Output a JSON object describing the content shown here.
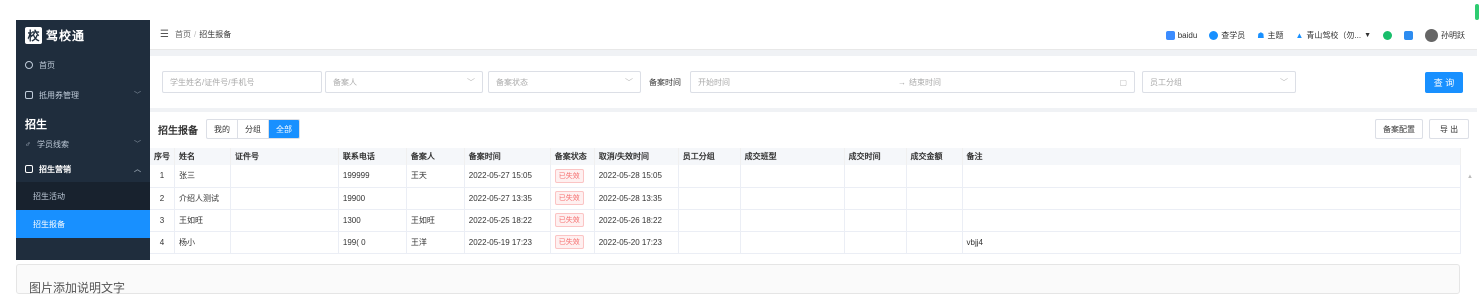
{
  "app": {
    "logo_char": "校",
    "name": "驾校通"
  },
  "sidebar": {
    "items": [
      {
        "label": "首页"
      },
      {
        "label": "抵用券管理"
      }
    ],
    "group": "招生",
    "lead_item": "学员线索",
    "marketing_item": "招生营销",
    "sub_items": [
      {
        "label": "招生活动"
      },
      {
        "label": "招生报备"
      }
    ]
  },
  "breadcrumb": {
    "home": "首页",
    "sep": "/",
    "current": "招生报备"
  },
  "topbar": {
    "baidu": "baidu",
    "students": "查学员",
    "theme": "主题",
    "school": "青山驾校（勿...",
    "user": "孙明跃"
  },
  "filter": {
    "student_placeholder": "学生姓名/证件号/手机号",
    "reporter_placeholder": "备案人",
    "status_placeholder": "备案状态",
    "time_label": "备案时间",
    "start_placeholder": "开始时间",
    "range_arrow": "→",
    "end_placeholder": "结束时间",
    "group_placeholder": "员工分组",
    "query_label": "查 询"
  },
  "panel": {
    "title": "招生报备",
    "tabs": [
      "我的",
      "分组",
      "全部"
    ],
    "active_tab": "全部",
    "config_label": "备案配置",
    "export_label": "导 出"
  },
  "table": {
    "headers": [
      "序号",
      "姓名",
      "证件号",
      "联系电话",
      "备案人",
      "备案时间",
      "备案状态",
      "取消/失效时间",
      "员工分组",
      "成交班型",
      "成交时间",
      "成交金额",
      "备注"
    ],
    "rows": [
      {
        "idx": "1",
        "name": "张三",
        "id": "",
        "phone": "199999",
        "reporter": "王天",
        "time": "2022-05-27 15:05",
        "status": "已失效",
        "cancel": "2022-05-28 15:05",
        "group": "",
        "class": "",
        "deal_time": "",
        "amount": "",
        "note": ""
      },
      {
        "idx": "2",
        "name": "介绍人测试",
        "id": "",
        "phone": "19900",
        "reporter": "",
        "time": "2022-05-27 13:35",
        "status": "已失效",
        "cancel": "2022-05-28 13:35",
        "group": "",
        "class": "",
        "deal_time": "",
        "amount": "",
        "note": ""
      },
      {
        "idx": "3",
        "name": "王如旺",
        "id": "",
        "phone": "1300",
        "reporter": "王如旺",
        "time": "2022-05-25 18:22",
        "status": "已失效",
        "cancel": "2022-05-26 18:22",
        "group": "",
        "class": "",
        "deal_time": "",
        "amount": "",
        "note": ""
      },
      {
        "idx": "4",
        "name": "杨小",
        "id": "",
        "phone": "199(         0",
        "reporter": "王洋",
        "time": "2022-05-19 17:23",
        "status": "已失效",
        "cancel": "2022-05-20 17:23",
        "group": "",
        "class": "",
        "deal_time": "",
        "amount": "",
        "note": "vbjj4"
      }
    ]
  },
  "caption": "图片添加说明文字",
  "colors": {
    "sidebar_bg": "#1f2d3d",
    "accent": "#1890ff",
    "status_red": "#f56c6c"
  }
}
